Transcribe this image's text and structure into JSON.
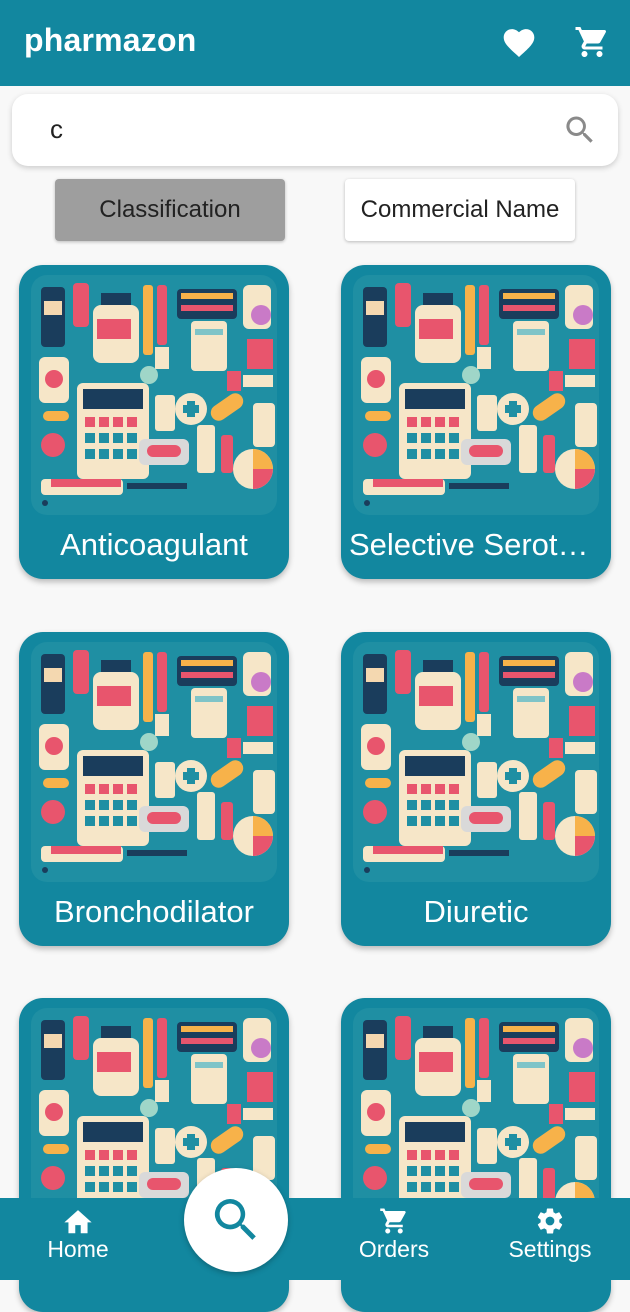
{
  "app": {
    "title": "pharmazon"
  },
  "search": {
    "value": "c"
  },
  "filters": {
    "classification": "Classification",
    "commercial_name": "Commercial Name",
    "active": "classification"
  },
  "cards": [
    {
      "label": "Anticoagulant"
    },
    {
      "label": "Selective Serotonin Reuptake Inhibitor"
    },
    {
      "label": "Bronchodilator"
    },
    {
      "label": "Diuretic"
    },
    {
      "label": ""
    },
    {
      "label": ""
    }
  ],
  "nav": {
    "home": "Home",
    "orders": "Orders",
    "settings": "Settings"
  },
  "colors": {
    "brand": "#12879f",
    "background": "#f8f8f8",
    "active_filter": "#9e9e9e"
  },
  "icons": {
    "favorite": "heart-icon",
    "cart": "cart-icon",
    "search": "search-icon",
    "home": "home-icon",
    "orders": "cart-icon",
    "settings": "gear-icon"
  }
}
